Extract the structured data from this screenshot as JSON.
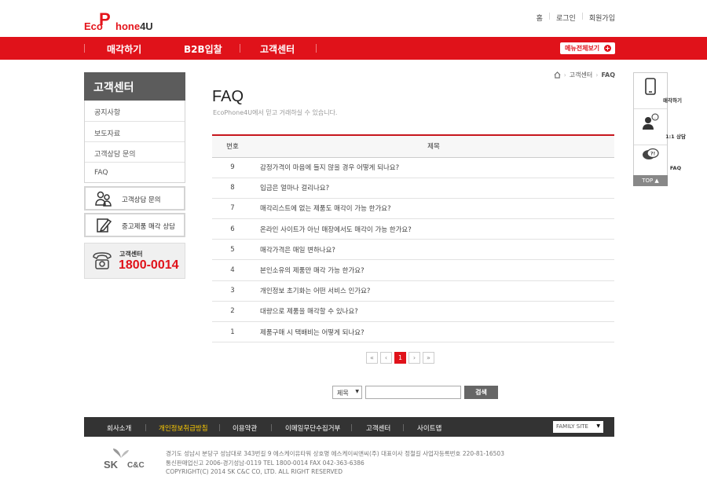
{
  "header": {
    "logo_eco": "Eco",
    "logo_p": "P",
    "logo_rest": "hone",
    "logo_4u": "4U",
    "links": [
      "홈",
      "로그인",
      "회원가입"
    ]
  },
  "gnb": {
    "items": [
      "매각하기",
      "B2B입찰",
      "고객센터"
    ],
    "all_menu": "메뉴전체보기"
  },
  "lnb": {
    "title": "고객센터",
    "items": [
      "공지사항",
      "보도자료",
      "고객상담 문의",
      "FAQ"
    ]
  },
  "side_buttons": {
    "consult": "고객상담 문의",
    "used_sell": "중고제품 매각 상담"
  },
  "cs": {
    "label": "고객센터",
    "phone": "1800-0014"
  },
  "breadcrumb": {
    "home_icon": "home-icon",
    "items": [
      "고객센터",
      "FAQ"
    ]
  },
  "page": {
    "title": "FAQ",
    "subtitle": "EcoPhone4U에서 믿고 거래하실 수 있습니다."
  },
  "table": {
    "headers": [
      "번호",
      "제목"
    ],
    "rows": [
      {
        "no": "9",
        "q": "감정가격이 마음에 들지 않을 경우 어떻게 되나요?"
      },
      {
        "no": "8",
        "q": "입금은 얼마나 걸리나요?"
      },
      {
        "no": "7",
        "q": "매각리스트에 없는 제품도 매각이 가능 한가요?"
      },
      {
        "no": "6",
        "q": "온라인 사이트가 아닌 매장에서도 매각이 가능 한가요?"
      },
      {
        "no": "5",
        "q": "매각가격은 매일 변하나요?"
      },
      {
        "no": "4",
        "q": "본인소유의 제품만 매각 가능 한가요?"
      },
      {
        "no": "3",
        "q": "개인정보 초기화는 어떤 서비스 인가요?"
      },
      {
        "no": "2",
        "q": "대량으로 제품을 매각할 수 있나요?"
      },
      {
        "no": "1",
        "q": "제품구매 시 택배비는 어떻게 되나요?"
      }
    ]
  },
  "paging": {
    "first": "«",
    "prev": "‹",
    "current": "1",
    "next": "›",
    "last": "»"
  },
  "search": {
    "select": "제목",
    "button": "검색"
  },
  "footer": {
    "nav": [
      "회사소개",
      "개인정보취급방침",
      "이용약관",
      "이메일무단수집거부",
      "고객센터",
      "사이트맵"
    ],
    "family": "FAMILY SITE",
    "address": [
      "경기도 성남시 분당구 성남대로 343번길 9 에스케이유타워  상호명 에스케이씨앤씨(주)  대표이사 정철길  사업자등록번호 220-81-16503",
      "통신판매업신고 2006-경기성남-0119  TEL 1800-0014  FAX 042-363-6386",
      "COPYRIGHT(C) 2014 SK C&C CO, LTD. ALL RIGHT RESERVED"
    ],
    "sk_logo": "SK",
    "cc_logo": "C&C"
  },
  "quick": {
    "items": [
      "매각하기",
      "1:1 상담",
      "FAQ"
    ],
    "top": "TOP ▲"
  },
  "colors": {
    "brand": "#e0121a",
    "dark": "#333333"
  }
}
